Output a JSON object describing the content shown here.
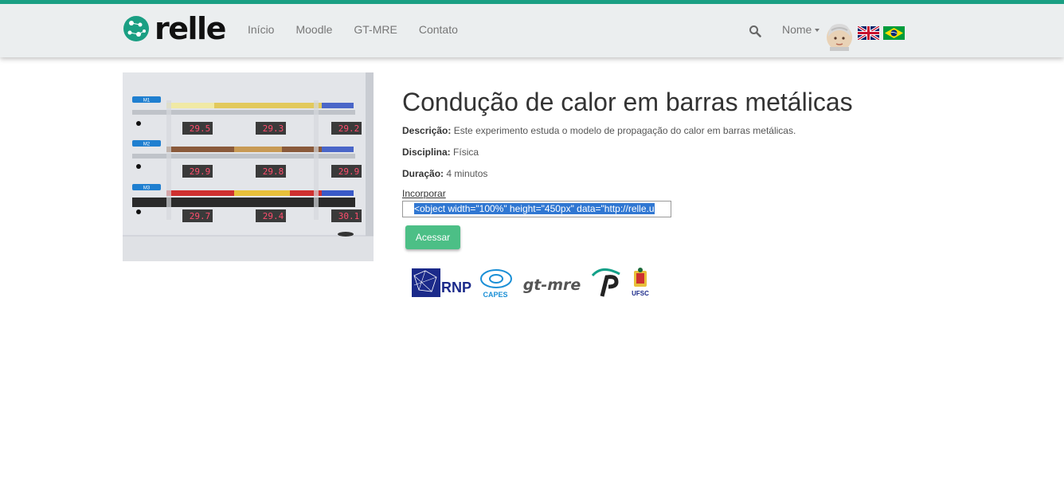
{
  "header": {
    "brand": "relle",
    "nav": [
      "Início",
      "Moodle",
      "GT-MRE",
      "Contato"
    ],
    "user_label": "Nome",
    "colors": {
      "accent": "#1a9f83",
      "bar": "#ebeeef"
    }
  },
  "experiment": {
    "title": "Condução de calor em barras metálicas",
    "description_label": "Descrição:",
    "description": "Este experimento estuda o modelo de propagação do calor em barras metálicas.",
    "discipline_label": "Disciplina:",
    "discipline": "Física",
    "duration_label": "Duração:",
    "duration": "4 minutos",
    "embed_label": "Incorporar",
    "embed_code": "<object width=\"100%\" height=\"450px\" data=\"http://relle.u",
    "access_button": "Acessar"
  },
  "photo": {
    "bars": [
      {
        "label": "M1",
        "displays": [
          "29.5",
          "29.3",
          "29.2"
        ]
      },
      {
        "label": "M2",
        "displays": [
          "29.9",
          "29.8",
          "29.9"
        ]
      },
      {
        "label": "M3",
        "displays": [
          "29.7",
          "29.4",
          "30.1"
        ]
      }
    ]
  },
  "partners": [
    "RNP",
    "CAPES",
    "gt-mre",
    "UFSC"
  ]
}
